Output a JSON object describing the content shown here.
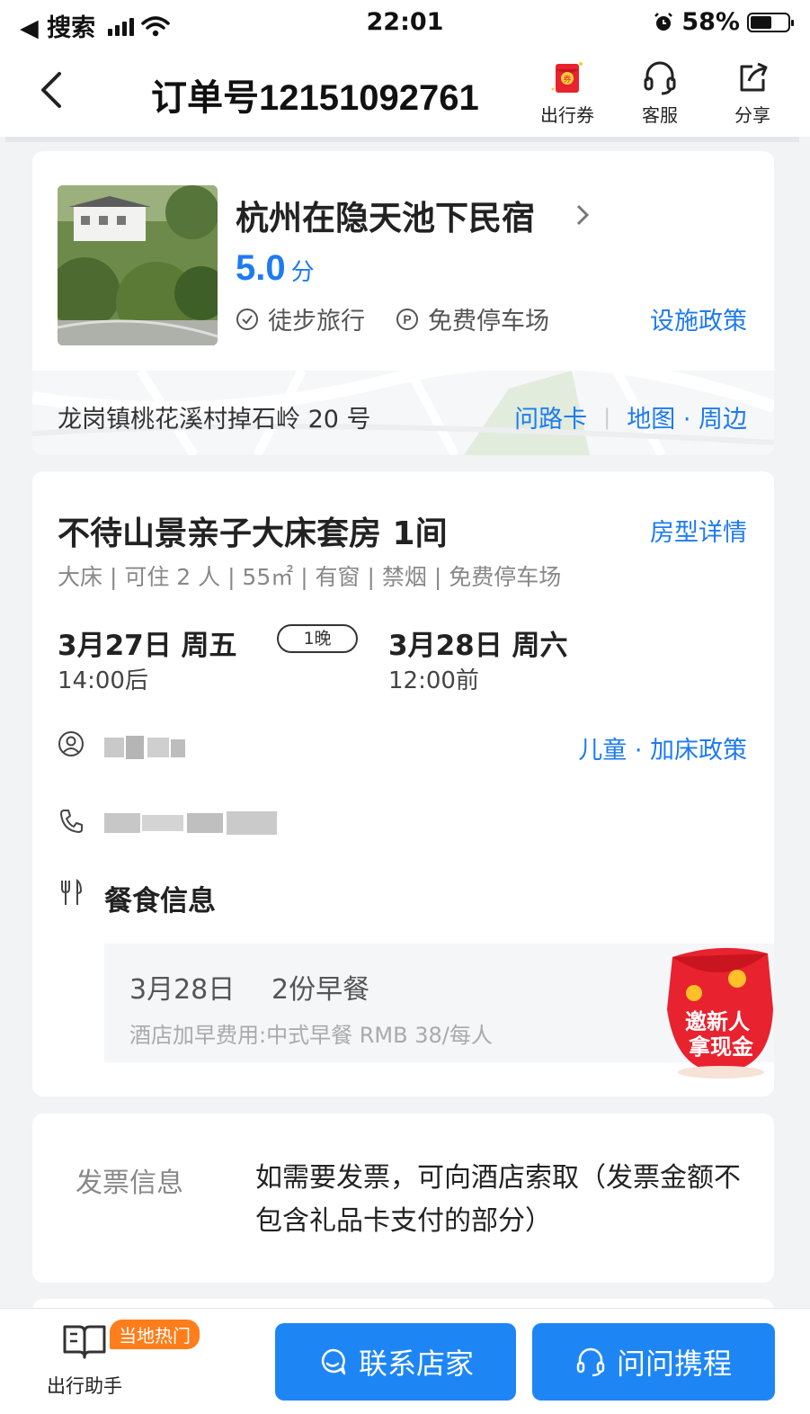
{
  "status_bar": {
    "back_app": "◀ 搜索",
    "time": "22:01",
    "battery": "58%"
  },
  "nav": {
    "title": "订单号12151092761",
    "actions": [
      {
        "label": "出行券",
        "icon": "coupon-icon"
      },
      {
        "label": "客服",
        "icon": "headset-icon"
      },
      {
        "label": "分享",
        "icon": "share-icon"
      }
    ]
  },
  "hotel": {
    "name": "杭州在隐天池下民宿",
    "score": "5.0",
    "score_unit": "分",
    "tags": [
      "徒步旅行",
      "免费停车场"
    ],
    "policy_link": "设施政策",
    "address": "龙岗镇桃花溪村掉石岭 20 号",
    "directions_card": "问路卡",
    "map_link": "地图 · 周边"
  },
  "room": {
    "name": "不待山景亲子大床套房 1间",
    "detail_link": "房型详情",
    "info": "大床 | 可住 2 人 | 55㎡ | 有窗 | 禁烟 | 免费停车场",
    "checkin_date": "3月27日 周五",
    "checkin_time": "14:00后",
    "nights": "1晚",
    "checkout_date": "3月28日 周六",
    "checkout_time": "12:00前",
    "child_policy_link": "儿童 · 加床政策",
    "meal_title": "餐食信息",
    "meal_date": "3月28日",
    "meal_qty": "2份早餐",
    "meal_fee": "酒店加早费用:中式早餐 RMB 38/每人"
  },
  "promo": {
    "line1": "邀新人",
    "line2": "拿现金"
  },
  "invoice": {
    "label": "发票信息",
    "text": "如需要发票，可向酒店索取（发票金额不包含礼品卡支付的部分）"
  },
  "bottom": {
    "assistant_label": "出行助手",
    "hot_badge": "当地热门",
    "contact_button": "联系店家",
    "ask_button": "问问携程"
  },
  "colors": {
    "accent": "#1e7bf0",
    "button": "#1e86f4",
    "badge": "#ff7d1a",
    "promo": "#e8222e"
  }
}
